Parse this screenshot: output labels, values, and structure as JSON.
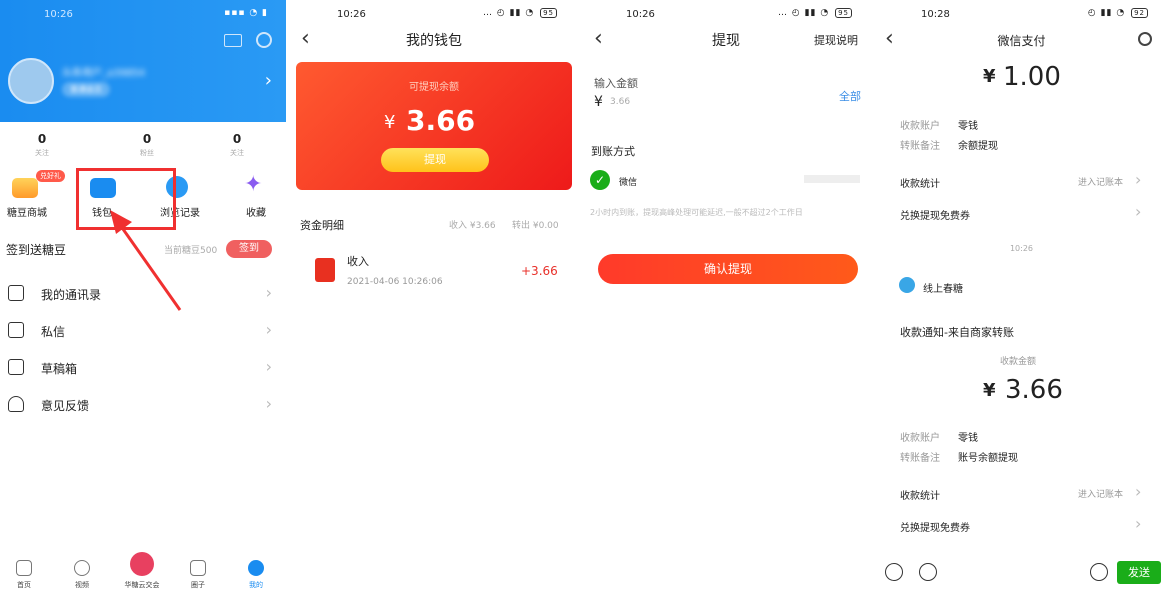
{
  "p1": {
    "status_time": "10:26",
    "username": "头条用户_a39854",
    "level": "普通会员",
    "stats": [
      {
        "value": "0",
        "label": "关注"
      },
      {
        "value": "0",
        "label": "粉丝"
      },
      {
        "value": "0",
        "label": "关注"
      }
    ],
    "grid": [
      {
        "label": "糖豆商城",
        "badge": "兑好礼"
      },
      {
        "label": "钱包"
      },
      {
        "label": "浏览记录"
      },
      {
        "label": "收藏"
      }
    ],
    "signin_title": "签到送糖豆",
    "signin_points": "当前糖豆500",
    "signin_button": "签到",
    "menu": [
      {
        "label": "我的通讯录"
      },
      {
        "label": "私信"
      },
      {
        "label": "草稿箱"
      },
      {
        "label": "意见反馈"
      }
    ],
    "tabs": [
      {
        "label": "首页"
      },
      {
        "label": "视频"
      },
      {
        "label": "华糖云交会"
      },
      {
        "label": "圈子"
      },
      {
        "label": "我的"
      }
    ]
  },
  "p2": {
    "status_time": "10:26",
    "battery": "95",
    "title": "我的钱包",
    "card_label": "可提现余额",
    "currency": "¥",
    "balance": "3.66",
    "withdraw_button": "提现",
    "section_title": "资金明细",
    "income_total": "收入 ¥3.66",
    "outflow_total": "转出 ¥0.00",
    "txn": {
      "title": "收入",
      "time": "2021-04-06 10:26:06",
      "amount": "+3.66"
    }
  },
  "p3": {
    "status_time": "10:26",
    "battery": "95",
    "title": "提现",
    "help_link": "提现说明",
    "amount_label": "输入金额",
    "currency": "¥",
    "amount_value": "3.66",
    "all_link": "全部",
    "method_label": "到账方式",
    "method_name": "微信",
    "notice": "2小时内到账，提现高峰处理可能延迟,一般不超过2个工作日",
    "confirm_button": "确认提现"
  },
  "p4": {
    "status_time": "10:28",
    "battery": "92",
    "title": "微信支付",
    "top_amount": "1.00",
    "currency": "¥",
    "top_kv": [
      {
        "k": "收款账户",
        "v": "零钱"
      },
      {
        "k": "转账备注",
        "v": "余额提现"
      }
    ],
    "stats_label": "收款统计",
    "ledger_link": "进入记账本",
    "coupon_label": "兑换提现免费券",
    "chat_time": "10:26",
    "sender": "线上春糖",
    "notice_title": "收款通知-来自商家转账",
    "amount_caption": "收款金额",
    "amount": "3.66",
    "bottom_kv": [
      {
        "k": "收款账户",
        "v": "零钱"
      },
      {
        "k": "转账备注",
        "v": "账号余额提现"
      }
    ],
    "send_button": "发送"
  },
  "colors": {
    "primary_blue": "#1a8cf0",
    "wallet_red": "#ee1a1a",
    "accent_red": "#e8302a",
    "highlight": "#f03030",
    "wechat_green": "#1aad19",
    "link_blue": "#3a8ee6"
  },
  "icons": [
    "mail-icon",
    "gear-icon",
    "chevron-right-icon",
    "back-icon",
    "wallet-icon",
    "star-icon",
    "shop-bag-icon",
    "history-icon",
    "contacts-icon",
    "message-icon",
    "draft-icon",
    "headset-icon",
    "home-icon",
    "video-icon",
    "circle-icon",
    "profile-icon",
    "wechat-icon",
    "red-envelope-icon",
    "emoji-icon",
    "voice-icon",
    "list-icon"
  ]
}
